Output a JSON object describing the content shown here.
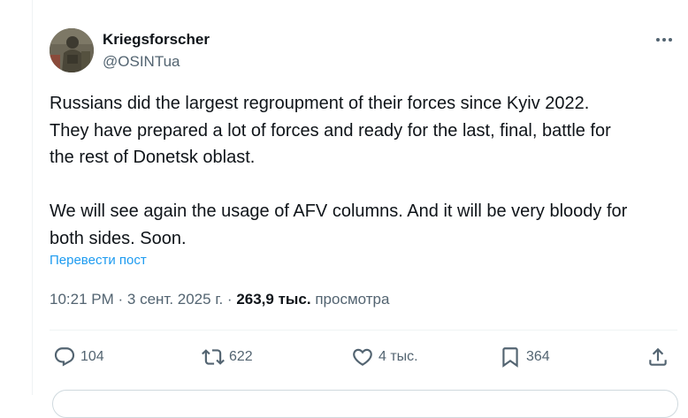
{
  "tweet": {
    "author": {
      "name": "Kriegsforscher",
      "handle": "@OSINTua",
      "avatar_icon": "soldier-avatar"
    },
    "more_icon": "more-horizontal-icon",
    "text_paragraphs": [
      [
        "Russians did the largest regroupment of their forces since Kyiv 2022.",
        "They have prepared a lot of forces and ready for the last, final, battle for",
        "the rest of Donetsk oblast."
      ],
      [
        "We will see again the usage of AFV columns. And it will be very bloody for",
        "both sides. Soon."
      ]
    ],
    "translate_label": "Перевести пост",
    "meta": {
      "time": "10:21 PM",
      "separator": "·",
      "date": "3 сент. 2025 г.",
      "views_count": "263,9 тыс.",
      "views_label": "просмотра"
    },
    "actions": {
      "replies": {
        "icon": "reply-icon",
        "count": "104"
      },
      "reposts": {
        "icon": "repost-icon",
        "count": "622"
      },
      "likes": {
        "icon": "like-icon",
        "count": "4 тыс."
      },
      "bookmarks": {
        "icon": "bookmark-icon",
        "count": "364"
      },
      "share": {
        "icon": "share-icon"
      }
    },
    "colors": {
      "text": "#0f1419",
      "secondary": "#536471",
      "link": "#1d9bf0",
      "divider": "#eff3f4"
    }
  }
}
